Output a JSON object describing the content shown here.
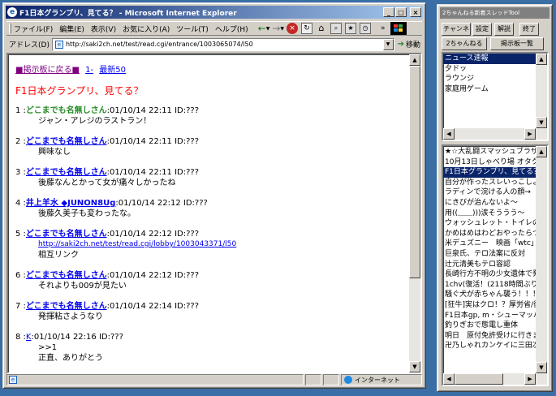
{
  "ie": {
    "title": "F1日本グランプリ、見てる？ - Microsoft Internet Explorer",
    "menu": [
      "ファイル(F)",
      "編集(E)",
      "表示(V)",
      "お気に入り(A)",
      "ツール(T)",
      "ヘルプ(H)"
    ],
    "address_label": "アドレス(D)",
    "address_value": "http://saki2ch.net/test/read.cgi/entrance/1003065074/l50",
    "go_label": "移動",
    "status_zone": "インターネット",
    "page": {
      "nav_back": "■掲示板に戻る■",
      "nav_all": "1-",
      "nav_latest": "最新50",
      "thread_title": "F1日本グランプリ、見てる？",
      "posts": [
        {
          "num": "1 :",
          "name": "どこまでも名無しさん",
          "meta": ":01/10/14 22:11 ID:???",
          "lines": [
            "ジャン・アレジのラストラン！"
          ]
        },
        {
          "num": "2 :",
          "name": "どこまでも名無しさん",
          "meta": ":01/10/14 22:11 ID:???",
          "lines": [
            "興味なし"
          ]
        },
        {
          "num": "3 :",
          "name": "どこまでも名無しさん",
          "meta": ":01/10/14 22:11 ID:???",
          "lines": [
            "後藤なんとかって女が痛々しかったね"
          ]
        },
        {
          "num": "4 :",
          "name": "井上羊水 ◆JUNON8Ug",
          "meta": ":01/10/14 22:12 ID:???",
          "lines": [
            "後藤久美子も変わったな。"
          ]
        },
        {
          "num": "5 :",
          "name": "どこまでも名無しさん",
          "meta": ":01/10/14 22:12 ID:???",
          "link": "http://saki2ch.net/test/read.cgi/lobby/1003043371/l50",
          "lines": [
            "相互リンク"
          ]
        },
        {
          "num": "6 :",
          "name": "どこまでも名無しさん",
          "meta": ":01/10/14 22:12 ID:???",
          "lines": [
            "それよりも009が見たい"
          ]
        },
        {
          "num": "7 :",
          "name": "どこまでも名無しさん",
          "meta": ":01/10/14 22:14 ID:???",
          "lines": [
            "発揮粘さようなり"
          ]
        },
        {
          "num": "8 :",
          "name": "K",
          "meta": ":01/10/14 22:16 ID:???",
          "lines": [
            ">>1",
            "正直、ありがとう"
          ]
        }
      ]
    }
  },
  "tool": {
    "title": "2ちゃんねる新着スレッドTool",
    "buttons": [
      "チャンネル",
      "設定",
      "解説",
      "終了"
    ],
    "buttons2": [
      "2ちゃんねる",
      "掲示板一覧"
    ],
    "boards": [
      "ニュース速報",
      "夕ドッ",
      "ラウンジ",
      "家庭用ゲーム"
    ],
    "threads": [
      "★☆大乱闘スマッシュブラザー",
      "10月13日しゃべり場 オタクじゃ",
      "F1日本グランプリ、見てる？",
      "自分が作ったスレいっこしよう",
      "ラディンで浣ける人の顔→",
      "にきびが治んないよ〜",
      "用((＿＿)))涙そううう〜",
      "ウォッシュレット・トイレの使い方",
      "かめはめはわどおやったらつかえる",
      "米デュズニー　映画「wtc」制作",
      "巨泉氏、テロ法案に反対",
      "辻元清美もテロ容認",
      "長崎行方不明の少女遺体で発見",
      "1chv(復活！(2118時間ぶり)",
      "騒ぐ犬が赤ちゃん襲う！！！",
      "[狂牛]実はクロ！？厚労省/後",
      "F1日本gp, m・シューマッハが優",
      "釣りぎおで態電し重体",
      "明日　原付免許受けに行きます",
      "卍乃しゃれカンケイに三田次男氏"
    ]
  }
}
